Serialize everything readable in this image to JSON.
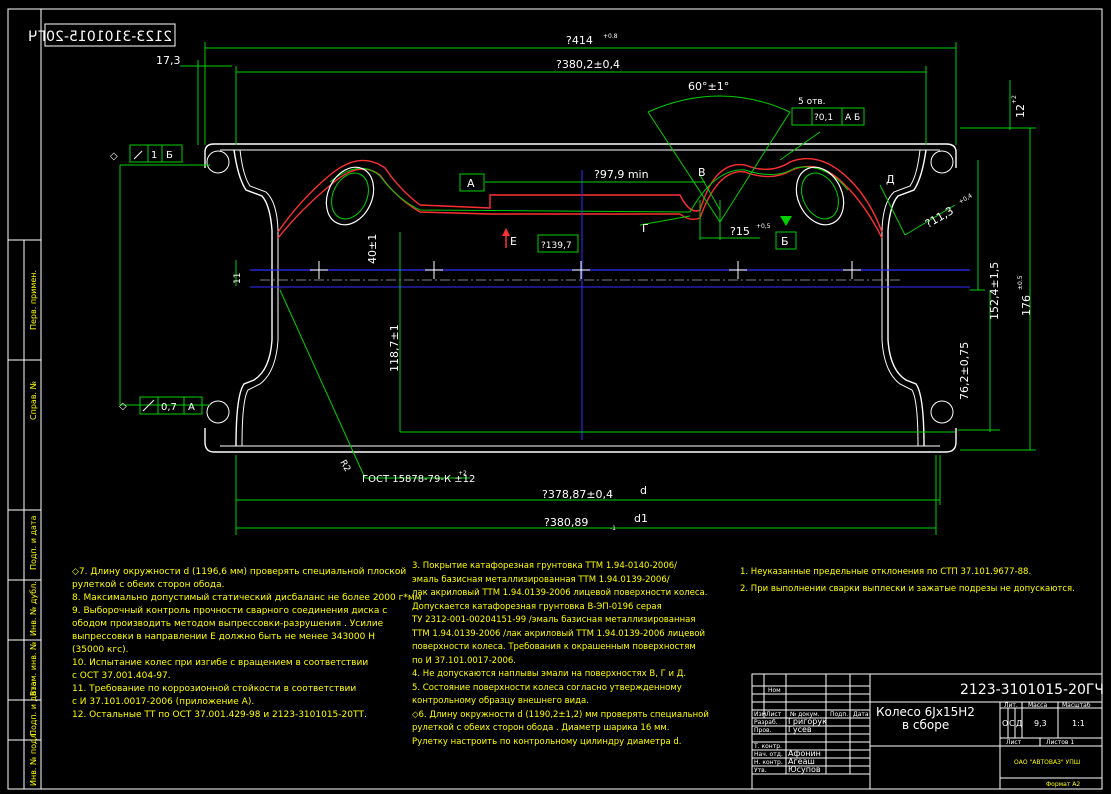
{
  "stamp_mirror": "2123-3101015-20ГЧ",
  "dimensions": {
    "d414": "?414",
    "d414_tol": "+0.8",
    "d380_2": "?380,2±0,4",
    "d17_3": "17,3",
    "angle60": "60°±1°",
    "holes": "5 отв.",
    "holes_tol": "?0,1",
    "holes_base": "А Б",
    "d12": "12",
    "d12_tol": "+2",
    "d97_9": "?97,9 min",
    "d139_7": "?139,7",
    "label_A": "А",
    "label_B": "Б",
    "label_V": "В",
    "label_G": "Г",
    "label_D": "Д",
    "label_E": "Е",
    "d15": "?15",
    "d15_tol": "+0,5",
    "d11_3": "?11,3",
    "d11_3_tol": "+0,4",
    "d40": "40±1",
    "d11": "11",
    "d118_7": "118,7±1",
    "d152_4": "152,4±1,5",
    "d176": "176",
    "d176_tol": "±0.5",
    "d76_2": "76,2±0,75",
    "d378_87": "?378,87±0,4",
    "d380_89": "?380,89",
    "d380_89_tol": "-1",
    "sym_d": "d",
    "sym_d1": "d1",
    "gost": "ГОСТ 15878-79-К ±12",
    "gost_sup": "+2",
    "r2": "R2",
    "tol_top_1": "1",
    "tol_top_2": "Б",
    "tol_bot_1": "0,7",
    "tol_bot_2": "А"
  },
  "notes_left": [
    "◇7. Длину окружности d   (1196,6    мм) проверять специальной плоской",
    "      рулеткой с обеих сторон обода.",
    "   8. Максимально допустимый статический дисбаланс не более 2000 г*мм",
    "   9. Выборочный контроль прочности сварного соединения диска с",
    "      ободом производить методом выпрессовки-разрушения . Усилие",
    "      выпрессовки в направлении Е должно быть не менее 343000 Н",
    "      (35000 кгс).",
    "  10. Испытание колес при изгибе с вращением в соответствии",
    "      с ОСТ 37.001.404-97.",
    "  11. Требование по коррозионной стойкости в соответствии",
    "      с И 37.101.0017-2006  (приложение А).",
    "  12. Остальные ТТ по ОСТ 37.001.429-98 и 2123-3101015-20ТТ."
  ],
  "notes_middle": [
    "3. Покрытие катафорезная грунтовка ТТМ 1.94-0140-2006/",
    "   эмаль базисная металлизированная ТТМ 1.94.0139-2006/",
    "   лак акриловый ТТМ 1.94.0139-2006 лицевой поверхности колеса.",
    "   Допускается катафорезная грунтовка В-ЭП-0196 серая",
    "   ТУ 2312-001-00204151-99 /эмаль базисная металлизированная",
    "   ТТМ 1.94.0139-2006 /лак акриловый ТТМ 1.94.0139-2006 лицевой",
    "   поверхности колеса. Требования к окрашенным поверхностям",
    "   по И 37.101.0017-2006.",
    "4. Не допускаются наплывы эмали на поверхностях В, Г и Д.",
    "5. Состояние поверхности колеса согласно утвержденному",
    "   контрольному образцу внешнего вида.",
    "◇6. Длину окружности d  (1190,2±1,2) мм проверять специальной",
    "   рулеткой с обеих сторон обода . Диаметр шарика 16 мм.",
    "   Рулетку настроить по контрольному цилиндру диаметра d."
  ],
  "notes_right": [
    "1. Неуказанные предельные отклонения по СТП 37.101.9677-88.",
    "2. При выполнении сварки выплески и зажатые подрезы не допускаются."
  ],
  "title_block": {
    "code": "2123-3101015-20ГЧ",
    "name_line1": "Колесо 6Jx15H2",
    "name_line2": "в сборе",
    "col_lit": "Лит.",
    "col_mass": "Масса",
    "col_scale": "Масштаб",
    "lit_values": [
      "О",
      "С",
      "Д"
    ],
    "mass": "9,3",
    "scale": "1:1",
    "sheet": "Лист",
    "sheets": "Листов 1",
    "company": "ОАО \"АВТОВАЗ\" УПШ",
    "format": "Формат А2",
    "row_labels": [
      "Изм",
      "Лист",
      "№ докум.",
      "Подп.",
      "Дата"
    ],
    "roles": [
      "Разраб.",
      "Пров.",
      "Т. контр.",
      "Нач. отд.",
      "Н. контр.",
      "Утв."
    ],
    "names": [
      "Григорук",
      "Гусев",
      "",
      "Афонин",
      "Агеаш",
      "Юсупов"
    ],
    "rev": "Ном"
  },
  "side_labels": [
    "Перв. примен.",
    "Справ. №",
    "Подп. и дата",
    "Инв. № дубл.",
    "Взам. инв. №",
    "Подп. и дата",
    "Инв. № подл."
  ]
}
